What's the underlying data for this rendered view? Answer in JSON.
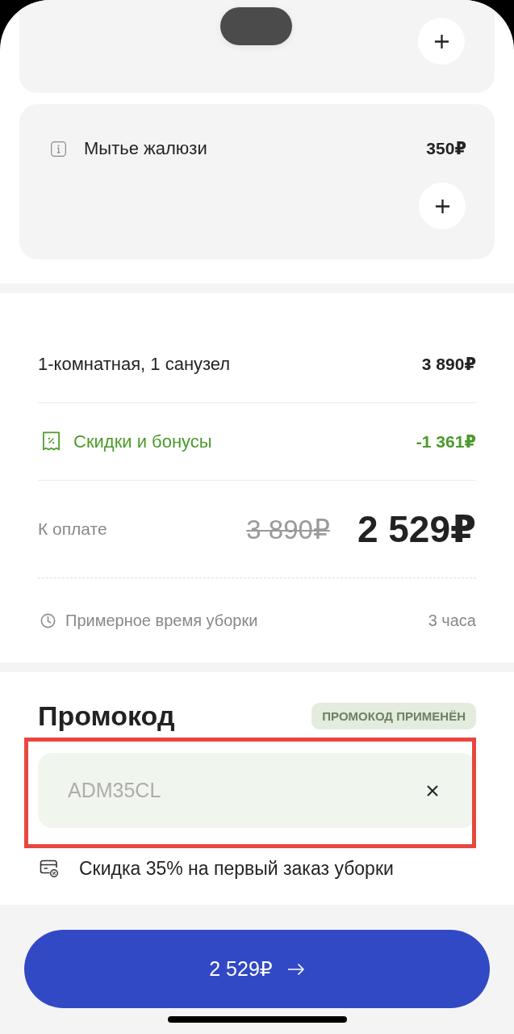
{
  "services": [
    {
      "kind": "cut"
    },
    {
      "kind": "item",
      "name": "Мытье жалюзи",
      "price": "350₽"
    }
  ],
  "summary": [
    {
      "kind": "line",
      "label": "1-комнатная, 1 санузел",
      "amount": "3 890₽"
    },
    {
      "kind": "discount",
      "label": "Скидки и бонусы",
      "amount": "-1 361₽"
    },
    {
      "kind": "total",
      "label": "К оплате",
      "old_amount": "3 890₽",
      "amount": "2 529₽"
    },
    {
      "kind": "time",
      "label": "Примерное время уборки",
      "amount": "3 часа"
    }
  ],
  "promo": {
    "title": "Промокод",
    "badge": "ПРОМОКОД ПРИМЕНЁН",
    "value": "ADM35CL",
    "highlighted": true,
    "note": "Скидка 35% на первый заказ уборки"
  },
  "pay_button": {
    "label": "2 529₽"
  }
}
